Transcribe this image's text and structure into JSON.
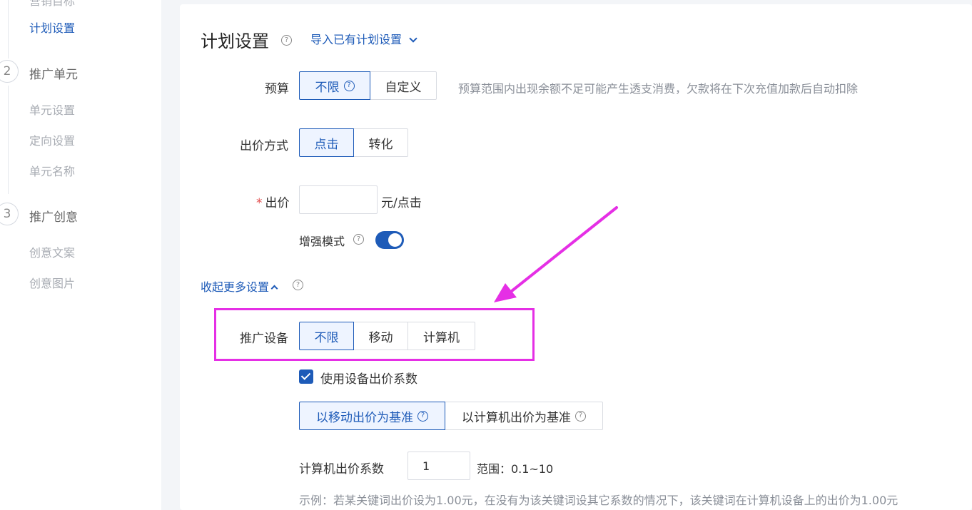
{
  "sidebar": {
    "top_cut_item": "营销目标",
    "plan_setting": "计划设置",
    "step2": {
      "num": "2",
      "title": "推广单元",
      "items": [
        "单元设置",
        "定向设置",
        "单元名称"
      ]
    },
    "step3": {
      "num": "3",
      "title": "推广创意",
      "items": [
        "创意文案",
        "创意图片"
      ]
    }
  },
  "main": {
    "title": "计划设置",
    "help_glyph": "?",
    "import_link": "导入已有计划设置",
    "budget": {
      "label": "预算",
      "options": [
        "不限",
        "自定义"
      ],
      "selected": "不限",
      "hint": "预算范围内出现余额不足可能产生透支消费，欠款将在下次充值加款后自动扣除"
    },
    "bid_method": {
      "label": "出价方式",
      "options": [
        "点击",
        "转化"
      ],
      "selected": "点击"
    },
    "bid": {
      "required_mark": "*",
      "label": "出价",
      "value": "",
      "unit": "元/点击"
    },
    "enhanced_mode": {
      "label": "增强模式",
      "enabled": true
    },
    "collapse_link": "收起更多设置",
    "device": {
      "label": "推广设备",
      "options": [
        "不限",
        "移动",
        "计算机"
      ],
      "selected": "不限"
    },
    "use_device_coef": {
      "label": "使用设备出价系数",
      "checked": true
    },
    "coef_base": {
      "options": [
        "以移动出价为基准",
        "以计算机出价为基准"
      ],
      "selected": "以移动出价为基准"
    },
    "pc_coef": {
      "label": "计算机出价系数",
      "value": "1",
      "range": "范围：0.1~10"
    },
    "example": "示例：若某关键词出价设为1.00元，在没有为该关键词设其它系数的情况下，该关键词在计算机设备上的出价为1.00元"
  },
  "colors": {
    "accent": "#1e5bb8",
    "annotation": "#e52fe5"
  }
}
